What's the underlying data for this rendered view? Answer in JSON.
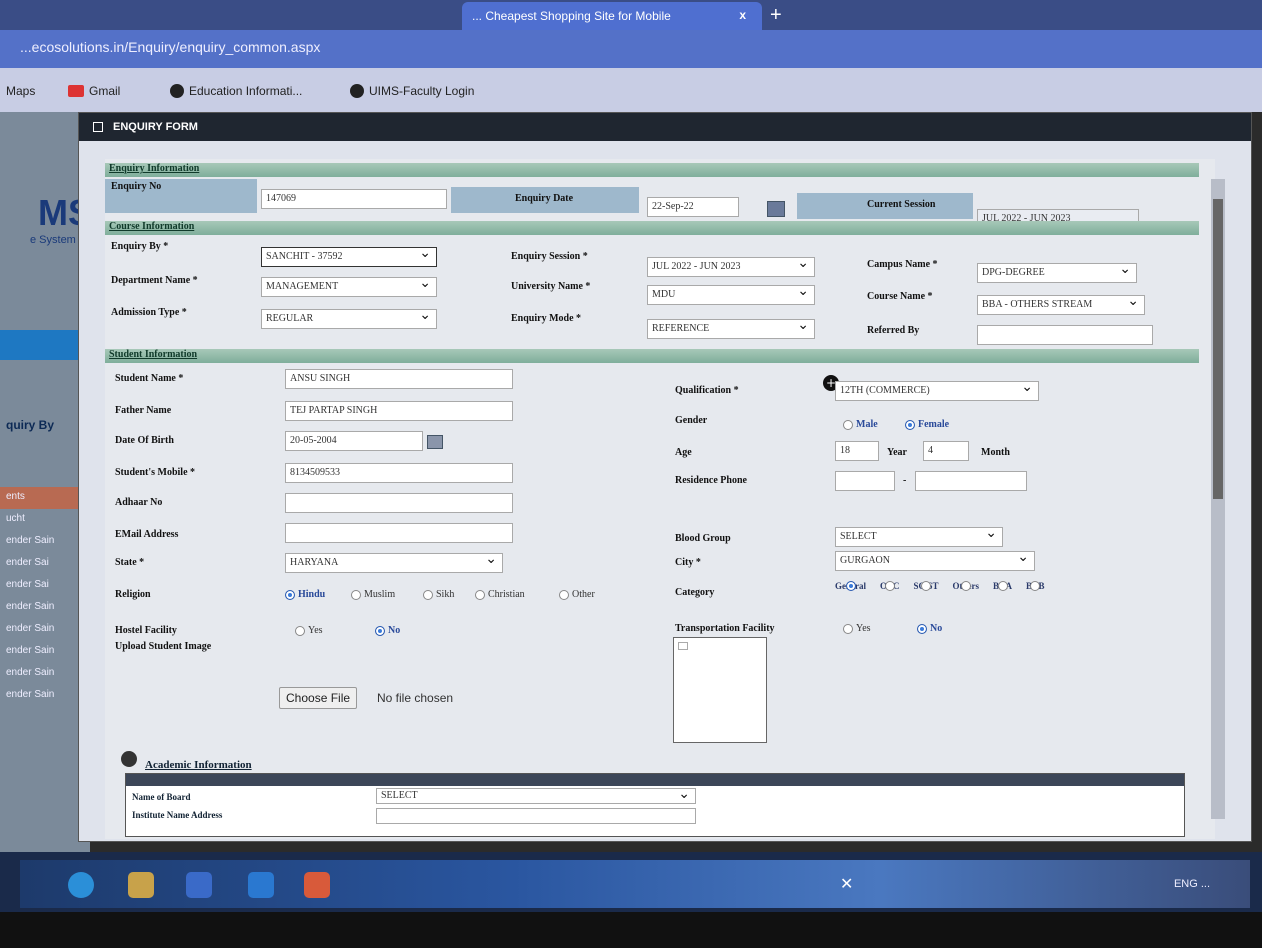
{
  "browser": {
    "tab_title": "... Cheapest Shopping Site for Mobile",
    "tab_close": "x",
    "new_tab": "+",
    "url": "...ecosolutions.in/Enquiry/enquiry_common.aspx",
    "bookmarks": [
      "Maps",
      "Gmail",
      "Education Informati...",
      "UIMS-Faculty Login"
    ]
  },
  "portal": {
    "logo": "MS",
    "logo_sub": "e System",
    "sidebar_label": "quiry By",
    "list": [
      "ents",
      "ucht",
      "ender Sain",
      "ender Sai",
      "ender Sai",
      "ender Sain",
      "ender Sain",
      "ender Sain",
      "ender Sain",
      "ender Sain"
    ]
  },
  "modal": {
    "title": "ENQUIRY FORM"
  },
  "enquiry_info": {
    "header": "Enquiry Information",
    "enquiry_no_label": "Enquiry No",
    "enquiry_no": "147069",
    "enquiry_date_label": "Enquiry Date",
    "enquiry_date": "22-Sep-22",
    "current_session_label": "Current Session",
    "current_session": "JUL 2022 - JUN 2023"
  },
  "course_info": {
    "header": "Course Information",
    "enquiry_by_label": "Enquiry By *",
    "enquiry_by": "SANCHIT - 37592",
    "department_label": "Department Name *",
    "department": "MANAGEMENT",
    "admission_type_label": "Admission Type *",
    "admission_type": "REGULAR",
    "enquiry_session_label": "Enquiry Session *",
    "enquiry_session": "JUL 2022 - JUN 2023",
    "university_label": "University Name *",
    "university": "MDU",
    "enquiry_mode_label": "Enquiry Mode *",
    "enquiry_mode": "REFERENCE",
    "campus_label": "Campus Name *",
    "campus": "DPG-DEGREE",
    "course_label": "Course Name *",
    "course": "BBA - OTHERS STREAM",
    "referred_by_label": "Referred By",
    "referred_by": ""
  },
  "student_info": {
    "header": "Student Information",
    "student_name_label": "Student Name *",
    "student_name": "ANSU SINGH",
    "father_name_label": "Father Name",
    "father_name": "TEJ PARTAP SINGH",
    "dob_label": "Date Of Birth",
    "dob": "20-05-2004",
    "mobile_label": "Student's Mobile *",
    "mobile": "8134509533",
    "adhaar_label": "Adhaar No",
    "adhaar": "",
    "email_label": "EMail Address",
    "email": "",
    "state_label": "State *",
    "state": "HARYANA",
    "religion_label": "Religion",
    "religion_options": [
      "Hindu",
      "Muslim",
      "Sikh",
      "Christian",
      "Other"
    ],
    "hostel_label": "Hostel Facility",
    "hostel_options": [
      "Yes",
      "No"
    ],
    "upload_label": "Upload Student Image",
    "choose_file": "Choose File",
    "no_file": "No file chosen",
    "qualification_label": "Qualification *",
    "qualification": "12TH (COMMERCE)",
    "gender_label": "Gender",
    "gender_options": [
      "Male",
      "Female"
    ],
    "age_label": "Age",
    "age_years": "18",
    "age_year_text": "Year",
    "age_months": "4",
    "age_month_text": "Month",
    "residence_phone_label": "Residence Phone",
    "phone_dash": "-",
    "blood_group_label": "Blood Group",
    "blood_group": "SELECT",
    "city_label": "City *",
    "city": "GURGAON",
    "category_label": "Category",
    "category_options": [
      "General",
      "OBC",
      "SC/ST",
      "Others",
      "BCA",
      "BCB"
    ],
    "transport_label": "Transportation Facility",
    "transport_options": [
      "Yes",
      "No"
    ]
  },
  "academic": {
    "title": "Academic Information",
    "board_label": "Name of Board",
    "board": "SELECT",
    "institute_label": "Institute Name Address"
  },
  "taskbar": {
    "tray_text": "ENG ..."
  }
}
